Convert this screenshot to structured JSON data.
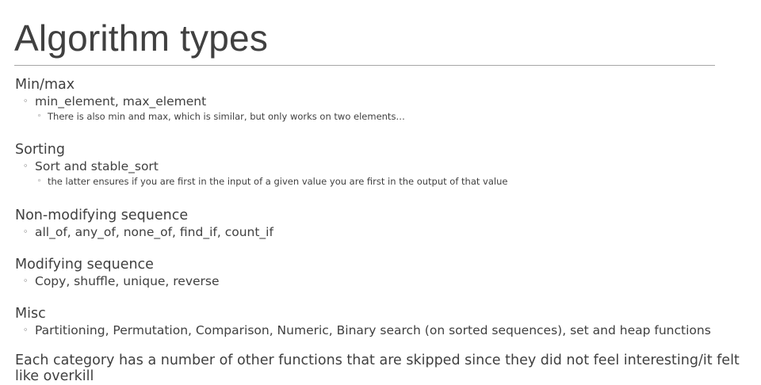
{
  "slide": {
    "title": "Algorithm types",
    "sections": [
      {
        "heading": "Min/max",
        "items": [
          {
            "text": "min_element, max_element",
            "subitems": [
              "There is also min and max, which is similar, but only works on two elements…"
            ]
          }
        ]
      },
      {
        "heading": "Sorting",
        "items": [
          {
            "text": "Sort and stable_sort",
            "subitems": [
              "the latter ensures if you are first in the input of a given value you are first in the output of that value"
            ]
          }
        ]
      },
      {
        "heading": "Non-modifying sequence",
        "items": [
          {
            "text": "all_of, any_of, none_of, find_if, count_if"
          }
        ]
      },
      {
        "heading": "Modifying sequence",
        "items": [
          {
            "text": "Copy, shuffle, unique, reverse"
          }
        ]
      },
      {
        "heading": "Misc",
        "items": [
          {
            "text": "Partitioning, Permutation, Comparison, Numeric, Binary search (on sorted sequences), set and heap functions"
          }
        ]
      }
    ],
    "closing": "Each category has a number of other functions that are skipped since they did not feel interesting/it felt like overkill"
  },
  "bullet_glyph": "◦",
  "colors": {
    "text": "#404040",
    "rule": "#a6a6a6",
    "background": "#ffffff"
  }
}
